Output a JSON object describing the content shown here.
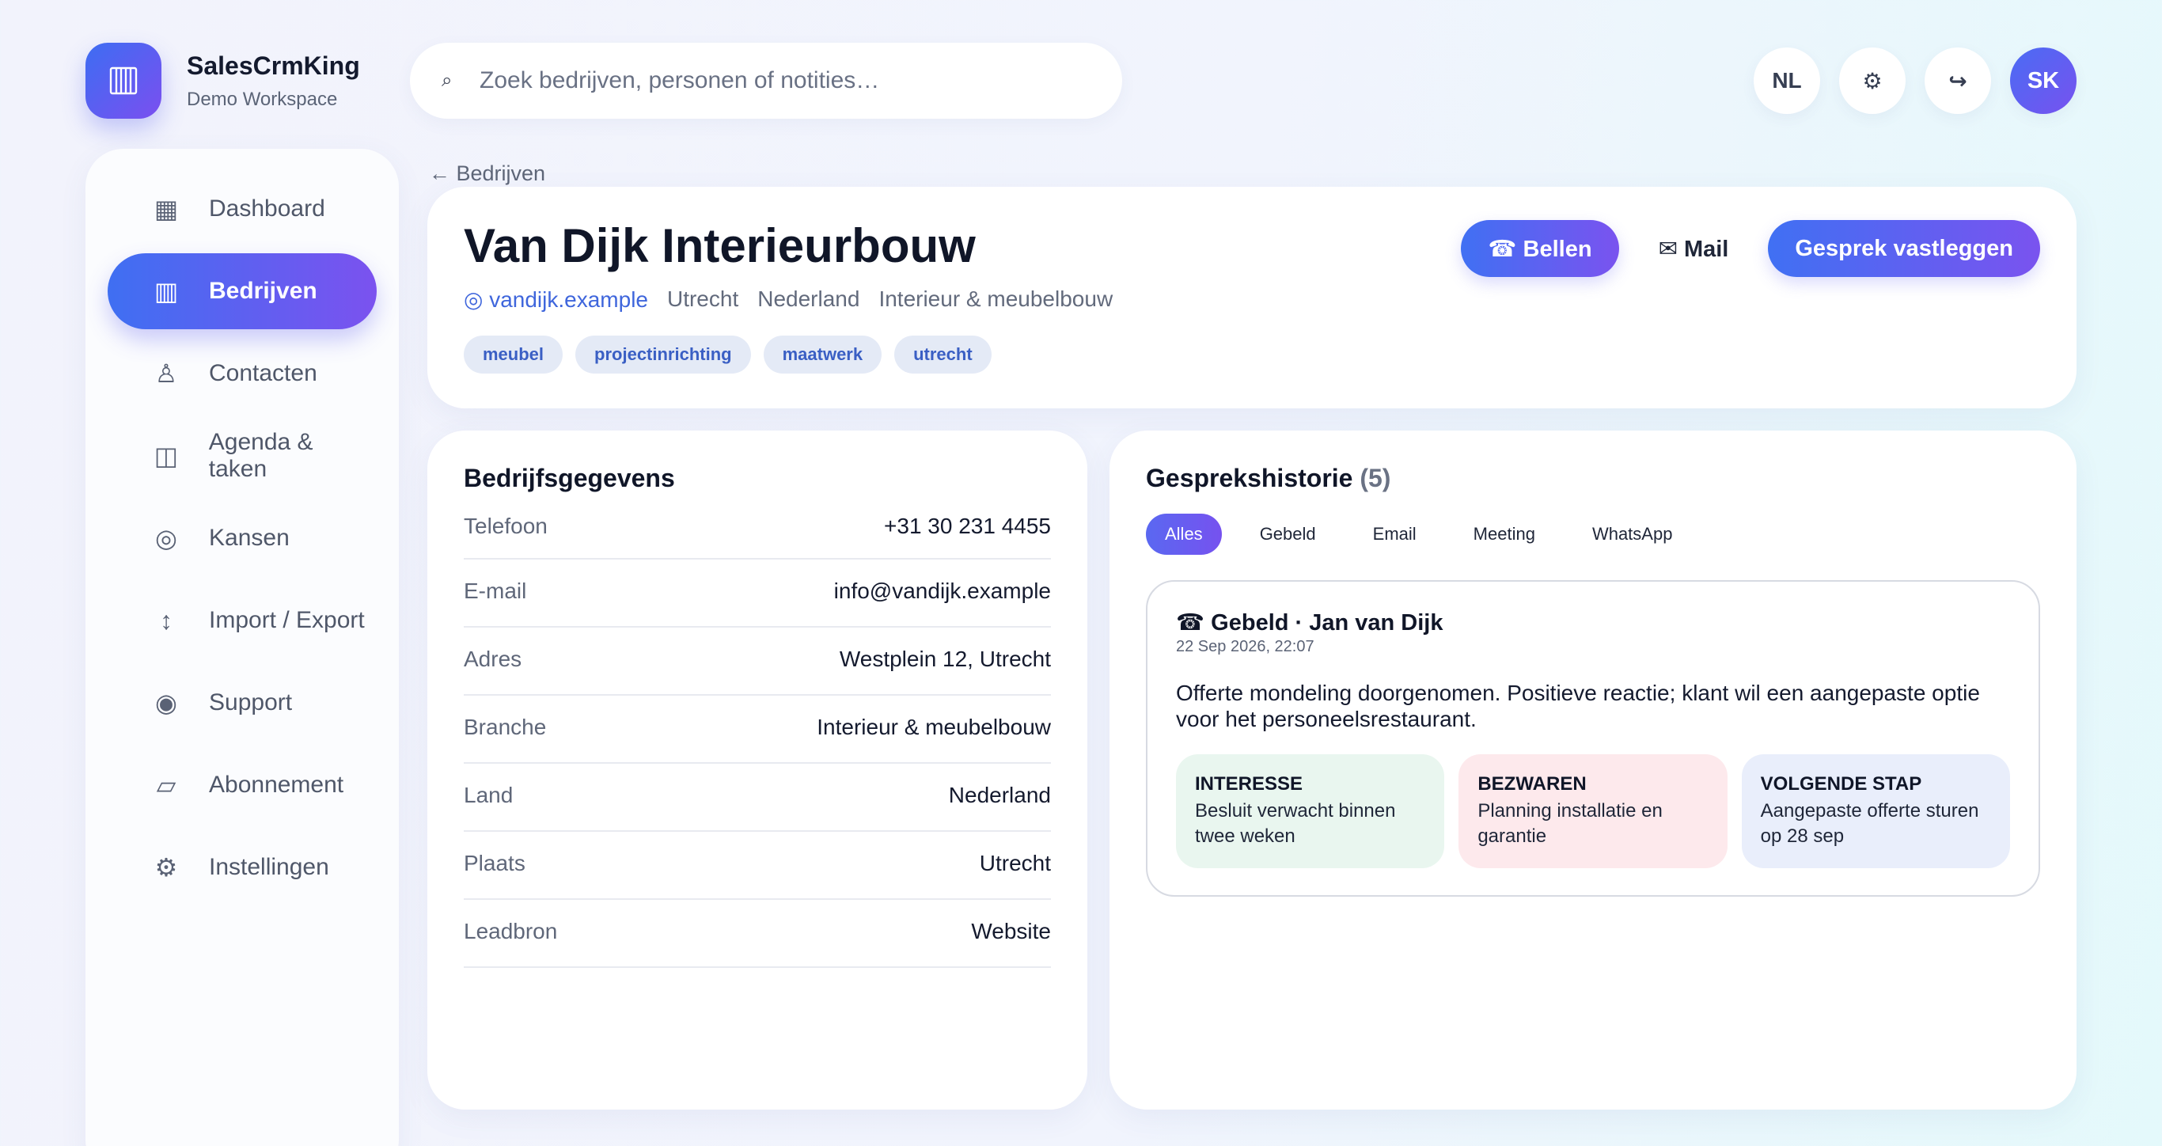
{
  "brand": {
    "name": "SalesCrmKing",
    "workspace": "Demo Workspace",
    "logo_icon": "building-icon",
    "accent_start": "#3d6df2",
    "accent_end": "#7b4ff0"
  },
  "search": {
    "icon": "search-icon",
    "placeholder": "Zoek bedrijven, personen of notities…",
    "value": ""
  },
  "top_actions": {
    "language": "NL",
    "settings_icon": "⚙",
    "logout_icon": "↪",
    "avatar_initials": "SK"
  },
  "sidebar": {
    "items": [
      {
        "icon": "▦",
        "label": "Dashboard",
        "active": false
      },
      {
        "icon": "▥",
        "label": "Bedrijven",
        "active": true
      },
      {
        "icon": "♙",
        "label": "Contacten",
        "active": false
      },
      {
        "icon": "◫",
        "label": "Agenda & taken",
        "active": false
      },
      {
        "icon": "◎",
        "label": "Kansen",
        "active": false
      },
      {
        "icon": "↕",
        "label": "Import / Export",
        "active": false
      },
      {
        "icon": "◉",
        "label": "Support",
        "active": false
      },
      {
        "icon": "▱",
        "label": "Abonnement",
        "active": false
      },
      {
        "icon": "⚙",
        "label": "Instellingen",
        "active": false
      }
    ]
  },
  "breadcrumb": {
    "label": "← Bedrijven"
  },
  "company": {
    "name": "Van Dijk Interieurbouw",
    "website": "◎ vandijk.example",
    "city": "Utrecht",
    "country": "Nederland",
    "industry": "Interieur & meubelbouw",
    "tags": [
      "meubel",
      "projectinrichting",
      "maatwerk",
      "utrecht"
    ],
    "actions": {
      "call": "☎ Bellen",
      "mail": "✉ Mail",
      "log": "Gesprek vastleggen"
    }
  },
  "details": {
    "title": "Bedrijfsgegevens",
    "rows": [
      {
        "key": "Telefoon",
        "value": "+31 30 231 4455"
      },
      {
        "key": "E-mail",
        "value": "info@vandijk.example"
      },
      {
        "key": "Adres",
        "value": "Westplein 12, Utrecht"
      },
      {
        "key": "Branche",
        "value": "Interieur & meubelbouw"
      },
      {
        "key": "Land",
        "value": "Nederland"
      },
      {
        "key": "Plaats",
        "value": "Utrecht"
      },
      {
        "key": "Leadbron",
        "value": "Website"
      }
    ]
  },
  "history": {
    "title": "Gesprekshistorie",
    "count": "(5)",
    "filters": [
      {
        "label": "Alles",
        "active": true
      },
      {
        "label": "Gebeld",
        "active": false
      },
      {
        "label": "Email",
        "active": false
      },
      {
        "label": "Meeting",
        "active": false
      },
      {
        "label": "WhatsApp",
        "active": false
      }
    ],
    "items": [
      {
        "title": "☎ Gebeld · Jan van Dijk",
        "time": "22 Sep 2026, 22:07",
        "body": "Offerte mondeling doorgenomen. Positieve reactie; klant wil een aangepaste optie voor het personeelsrestaurant.",
        "interest_label": "INTERESSE",
        "interest_text": "Besluit verwacht binnen twee weken",
        "objections_label": "BEZWAREN",
        "objections_text": "Planning installatie en garantie",
        "next_label": "VOLGENDE STAP",
        "next_text": "Aangepaste offerte sturen op 28 sep"
      }
    ]
  }
}
